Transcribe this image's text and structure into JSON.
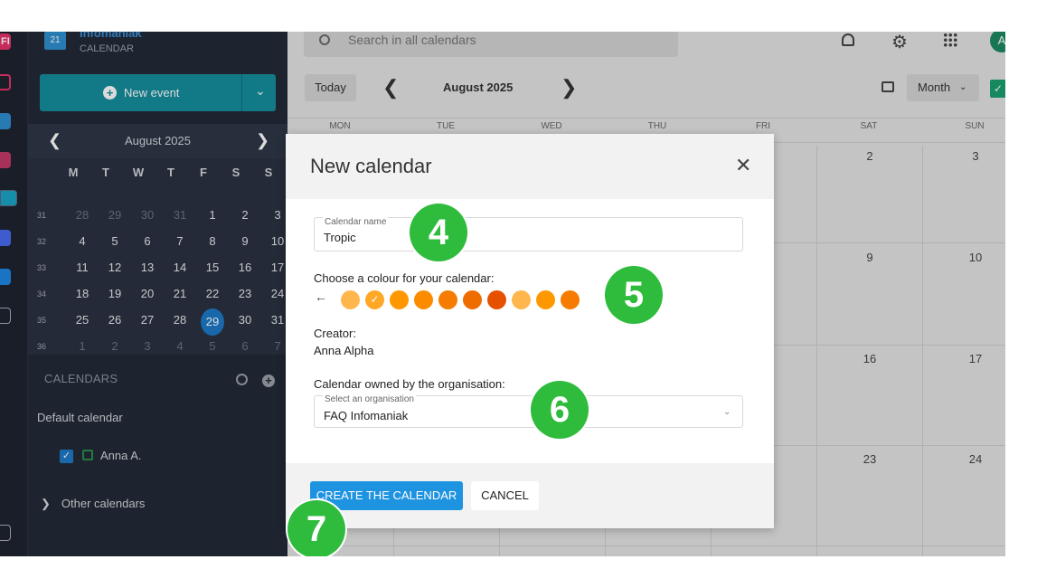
{
  "brand": {
    "name": "Infomaniak",
    "app": "CALENDAR",
    "logo_day": "21"
  },
  "rail": {
    "top_app_label": "FI"
  },
  "sidebar": {
    "new_event_label": "New event",
    "mini_calendar": {
      "title": "August  2025",
      "weekdays": [
        "M",
        "T",
        "W",
        "T",
        "F",
        "S",
        "S"
      ],
      "weeks": [
        {
          "num": "31",
          "days": [
            "28",
            "29",
            "30",
            "31",
            "1",
            "2",
            "3"
          ]
        },
        {
          "num": "32",
          "days": [
            "4",
            "5",
            "6",
            "7",
            "8",
            "9",
            "10"
          ]
        },
        {
          "num": "33",
          "days": [
            "11",
            "12",
            "13",
            "14",
            "15",
            "16",
            "17"
          ]
        },
        {
          "num": "34",
          "days": [
            "18",
            "19",
            "20",
            "21",
            "22",
            "23",
            "24"
          ]
        },
        {
          "num": "35",
          "days": [
            "25",
            "26",
            "27",
            "28",
            "29",
            "30",
            "31"
          ]
        },
        {
          "num": "36",
          "days": [
            "1",
            "2",
            "3",
            "4",
            "5",
            "6",
            "7"
          ]
        }
      ]
    },
    "calendars_heading": "CALENDARS",
    "default_calendar": "Default calendar",
    "user_calendar": "Anna A.",
    "other_calendars": "Other calendars"
  },
  "header": {
    "search_placeholder": "Search in all calendars",
    "avatar_initial": "A",
    "today_label": "Today",
    "month_title": "August 2025",
    "view_label": "Month"
  },
  "grid": {
    "weekdays": [
      "MON",
      "TUE",
      "WED",
      "THU",
      "FRI",
      "SAT",
      "SUN"
    ],
    "visible_dates": {
      "sat": [
        "2",
        "9",
        "16",
        "23"
      ],
      "sun": [
        "3",
        "10",
        "17",
        "24"
      ]
    }
  },
  "modal": {
    "title": "New calendar",
    "name_label": "Calendar name",
    "name_value": "Tropic",
    "colour_label": "Choose a colour for your calendar:",
    "colours": [
      "#ffb74d",
      "#ffa726",
      "#ff9800",
      "#fb8c00",
      "#f57c00",
      "#ef6c00",
      "#e65100",
      "#ffb74d",
      "#ff9800",
      "#f57c00"
    ],
    "selected_colour_index": 1,
    "creator_label": "Creator:",
    "creator_value": "Anna Alpha",
    "org_label": "Calendar owned by the organisation:",
    "org_field_label": "Select an organisation",
    "org_value": "FAQ Infomaniak",
    "create_label": "CREATE THE CALENDAR",
    "cancel_label": "CANCEL"
  },
  "steps": [
    "4",
    "5",
    "6",
    "7"
  ]
}
